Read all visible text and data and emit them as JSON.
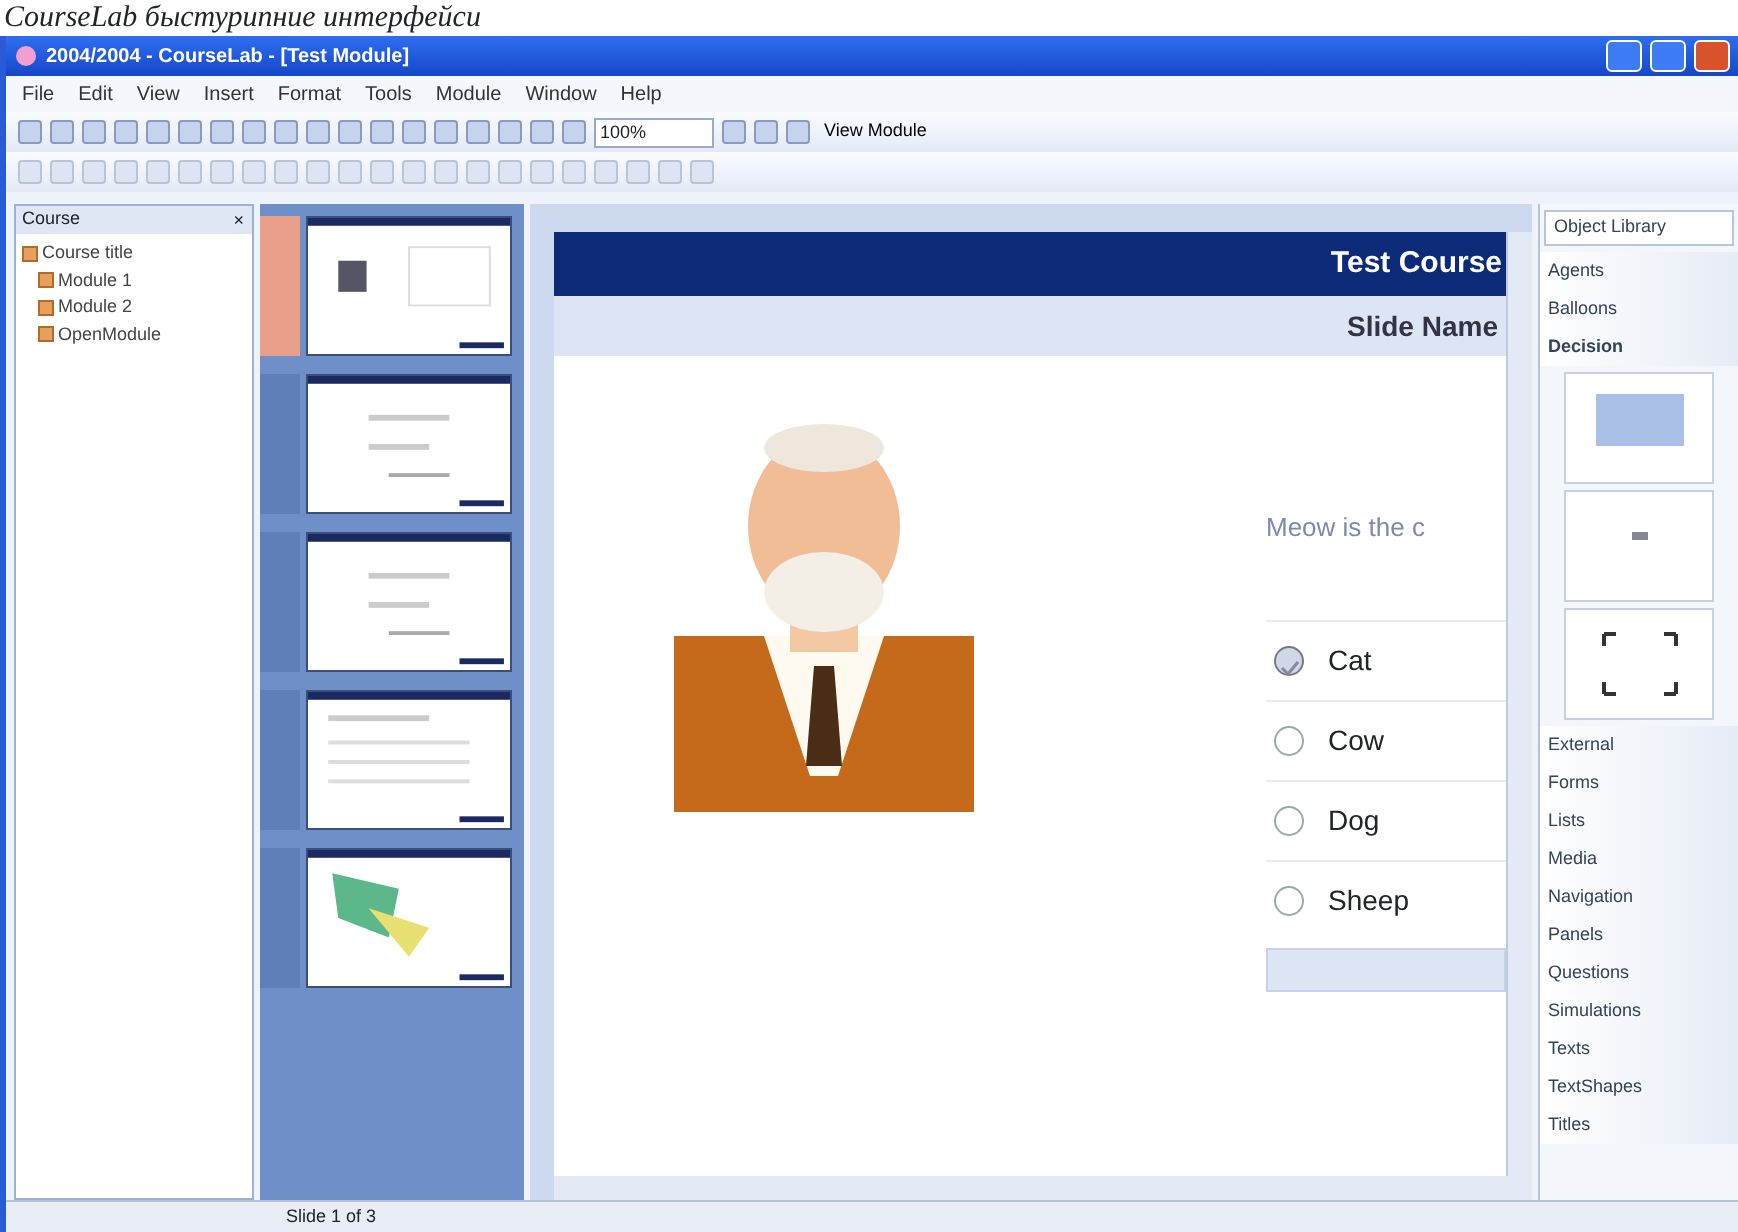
{
  "caption": "CourseLab быстурипние интерфейси",
  "window": {
    "title": "2004/2004 - CourseLab - [Test Module]"
  },
  "menu": [
    "File",
    "Edit",
    "View",
    "Insert",
    "Format",
    "Tools",
    "Module",
    "Window",
    "Help"
  ],
  "toolbar": {
    "zoom": "100%",
    "view_button": "View Module"
  },
  "course_tree": {
    "title": "Course",
    "close": "×",
    "items": [
      {
        "label": "Course title",
        "children": [
          {
            "label": "Module 1"
          },
          {
            "label": "Module 2"
          },
          {
            "label": "OpenModule"
          }
        ]
      }
    ]
  },
  "thumbnails": [
    {
      "kind": "person",
      "selected": true
    },
    {
      "kind": "text",
      "selected": false
    },
    {
      "kind": "text",
      "selected": false
    },
    {
      "kind": "list",
      "selected": false
    },
    {
      "kind": "image",
      "selected": false
    }
  ],
  "slide": {
    "course_title": "Test Course",
    "slide_name": "Slide Name",
    "question": "Meow is the c",
    "options": [
      {
        "label": "Cat",
        "selected": true
      },
      {
        "label": "Cow",
        "selected": false
      },
      {
        "label": "Dog",
        "selected": false
      },
      {
        "label": "Sheep",
        "selected": false
      }
    ]
  },
  "library": {
    "title": "Object Library",
    "categories": [
      {
        "label": "Agents",
        "expanded": false
      },
      {
        "label": "Balloons",
        "expanded": false
      },
      {
        "label": "Decision",
        "expanded": true
      },
      {
        "label": "External",
        "expanded": false
      },
      {
        "label": "Forms",
        "expanded": false
      },
      {
        "label": "Lists",
        "expanded": false
      },
      {
        "label": "Media",
        "expanded": false
      },
      {
        "label": "Navigation",
        "expanded": false
      },
      {
        "label": "Panels",
        "expanded": false
      },
      {
        "label": "Questions",
        "expanded": false
      },
      {
        "label": "Simulations",
        "expanded": false
      },
      {
        "label": "Texts",
        "expanded": false
      },
      {
        "label": "TextShapes",
        "expanded": false
      },
      {
        "label": "Titles",
        "expanded": false
      }
    ]
  },
  "status_bar": {
    "slide": "Slide 1 of 3"
  }
}
